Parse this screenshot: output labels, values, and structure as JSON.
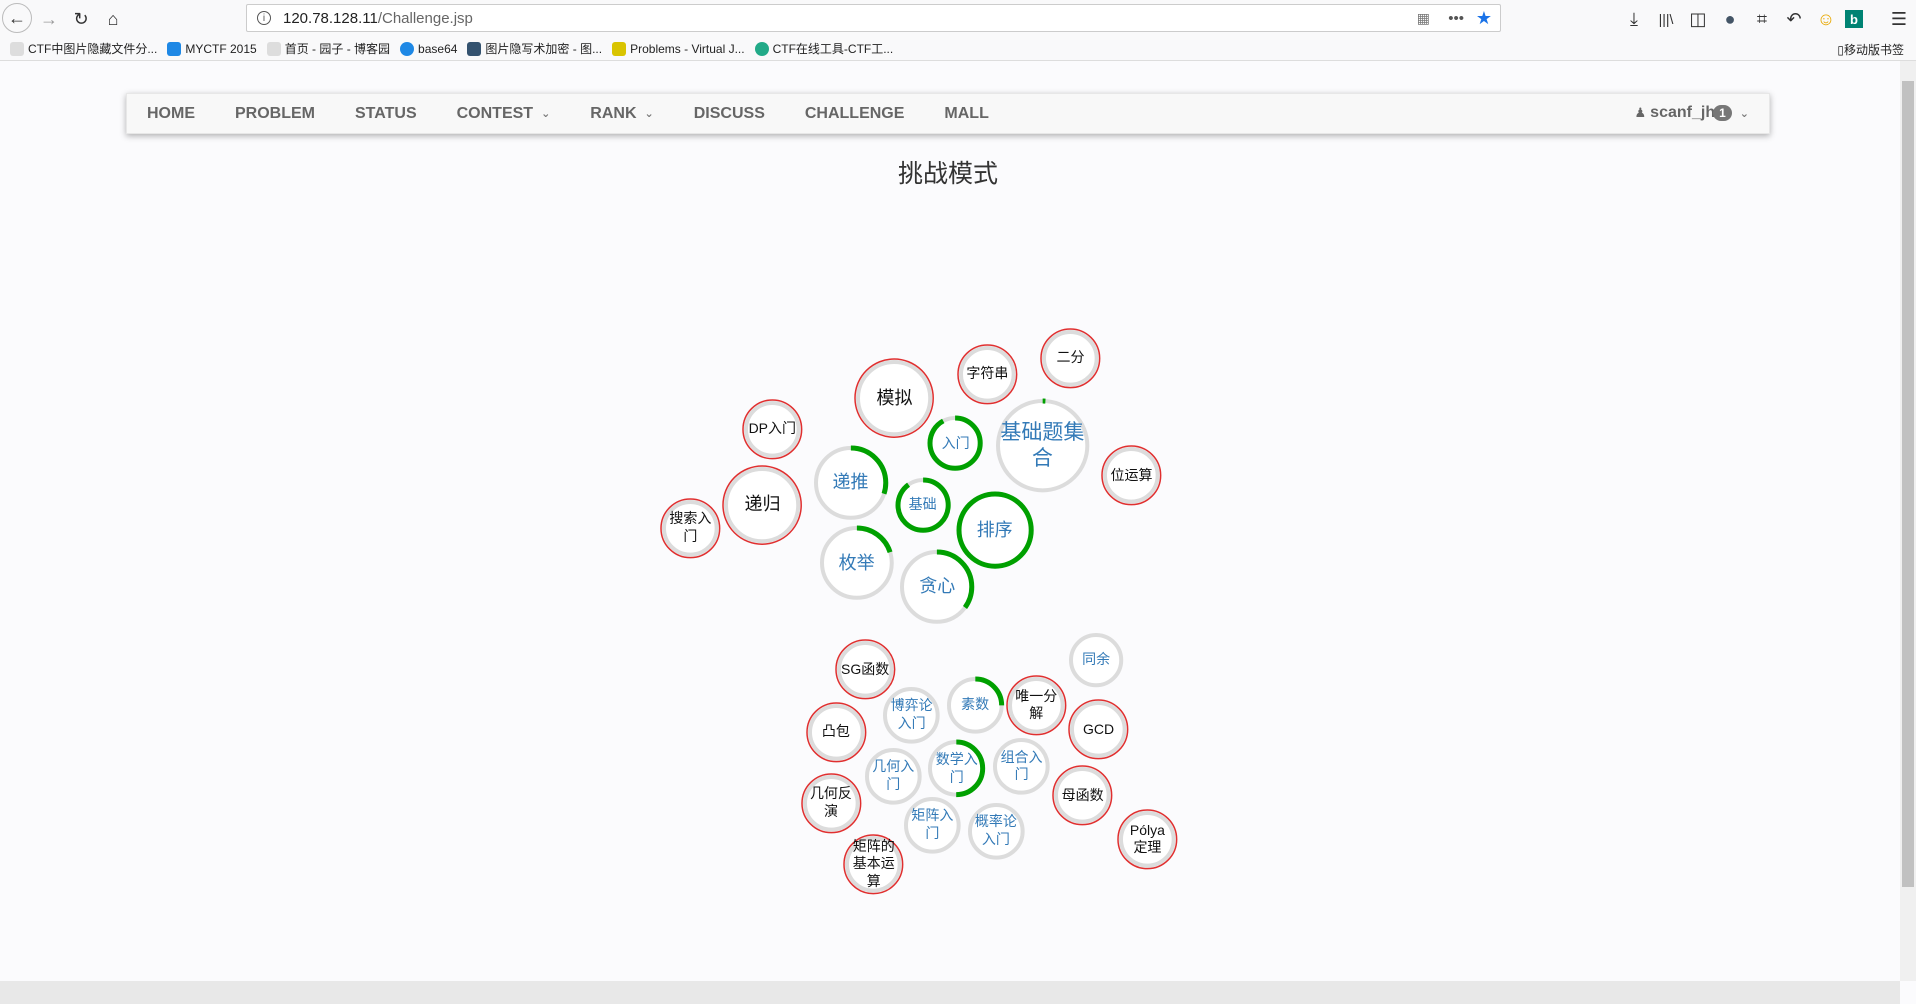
{
  "browser": {
    "url_host": "120.78.128.11",
    "url_path": "/Challenge.jsp",
    "bookmarks": [
      "CTF中图片隐藏文件分...",
      "MYCTF 2015",
      "首页 - 园子 - 博客园",
      "base64",
      "图片隐写术加密 - 图...",
      "Problems - Virtual J...",
      "CTF在线工具-CTF工..."
    ],
    "mobile_bookmarks": "移动版书签"
  },
  "nav": {
    "items": [
      {
        "label": "HOME",
        "dropdown": false
      },
      {
        "label": "PROBLEM",
        "dropdown": false
      },
      {
        "label": "STATUS",
        "dropdown": false
      },
      {
        "label": "CONTEST",
        "dropdown": true
      },
      {
        "label": "RANK",
        "dropdown": true
      },
      {
        "label": "DISCUSS",
        "dropdown": false
      },
      {
        "label": "CHALLENGE",
        "dropdown": false
      },
      {
        "label": "MALL",
        "dropdown": false
      }
    ],
    "user": "scanf_jh",
    "badge": "1"
  },
  "page_title": "挑战模式",
  "colors": {
    "locked": "#e02f2f",
    "progress": "#00a000",
    "ring": "#dcdcdc",
    "link_text": "#337ab7"
  },
  "challenges": [
    {
      "label": "模拟",
      "state": "locked",
      "progress": 0
    },
    {
      "label": "字符串",
      "state": "locked",
      "progress": 0
    },
    {
      "label": "二分",
      "state": "locked",
      "progress": 0
    },
    {
      "label": "DP入门",
      "state": "locked",
      "progress": 0
    },
    {
      "label": "入门",
      "state": "open",
      "progress": 0.92
    },
    {
      "label": "基础题集合",
      "state": "open",
      "progress": 0.01
    },
    {
      "label": "位运算",
      "state": "locked",
      "progress": 0
    },
    {
      "label": "递推",
      "state": "open",
      "progress": 0.3
    },
    {
      "label": "递归",
      "state": "locked",
      "progress": 0
    },
    {
      "label": "基础",
      "state": "open",
      "progress": 0.9
    },
    {
      "label": "排序",
      "state": "open",
      "progress": 1
    },
    {
      "label": "搜索入门",
      "state": "locked",
      "progress": 0
    },
    {
      "label": "枚举",
      "state": "open",
      "progress": 0.2
    },
    {
      "label": "贪心",
      "state": "open",
      "progress": 0.35
    },
    {
      "label": "SG函数",
      "state": "locked",
      "progress": 0
    },
    {
      "label": "同余",
      "state": "open",
      "progress": 0
    },
    {
      "label": "博弈论入门",
      "state": "open",
      "progress": 0
    },
    {
      "label": "素数",
      "state": "open",
      "progress": 0.25
    },
    {
      "label": "唯一分解",
      "state": "locked",
      "progress": 0
    },
    {
      "label": "凸包",
      "state": "locked",
      "progress": 0
    },
    {
      "label": "GCD",
      "state": "locked",
      "progress": 0
    },
    {
      "label": "几何入门",
      "state": "open",
      "progress": 0
    },
    {
      "label": "数学入门",
      "state": "open",
      "progress": 0.5
    },
    {
      "label": "组合入门",
      "state": "open",
      "progress": 0
    },
    {
      "label": "母函数",
      "state": "locked",
      "progress": 0
    },
    {
      "label": "几何反演",
      "state": "locked",
      "progress": 0
    },
    {
      "label": "矩阵入门",
      "state": "open",
      "progress": 0
    },
    {
      "label": "概率论入门",
      "state": "open",
      "progress": 0
    },
    {
      "label": "Pólya定理",
      "state": "locked",
      "progress": 0
    },
    {
      "label": "矩阵的基本运算",
      "state": "locked",
      "progress": 0
    }
  ]
}
